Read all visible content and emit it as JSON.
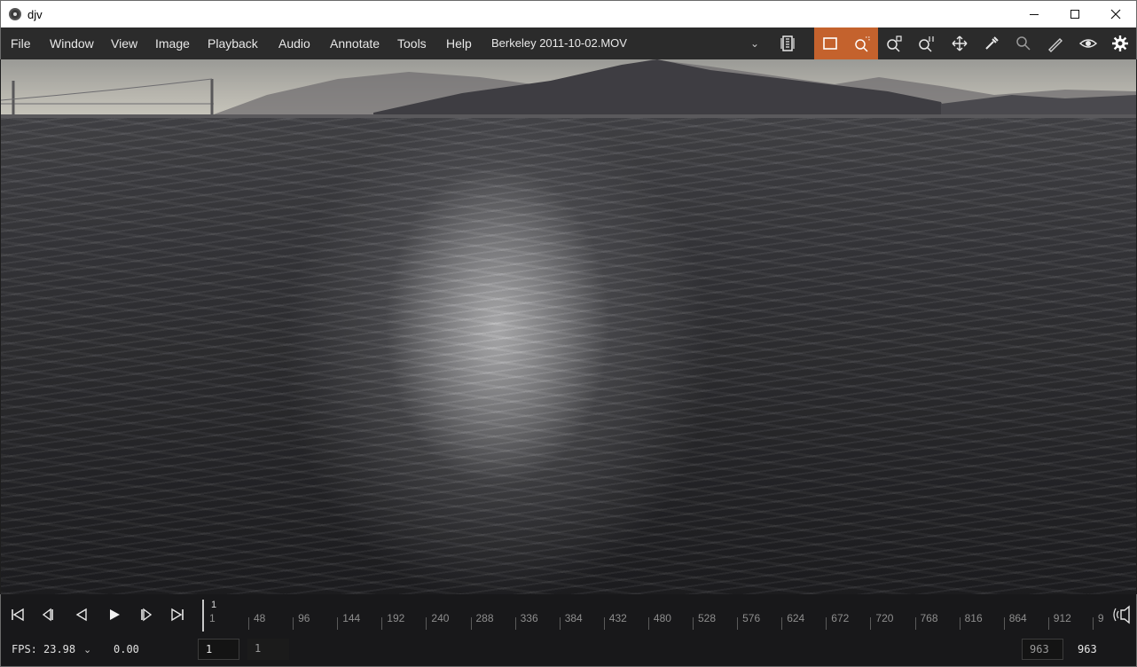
{
  "window": {
    "title": "djv"
  },
  "menu": {
    "items": [
      {
        "label": "File"
      },
      {
        "label": "Window"
      },
      {
        "label": "View"
      },
      {
        "label": "Image"
      },
      {
        "label": "Playback"
      },
      {
        "label": "Audio"
      },
      {
        "label": "Annotate"
      },
      {
        "label": "Tools"
      },
      {
        "label": "Help"
      }
    ],
    "current_file": "Berkeley 2011-10-02.MOV"
  },
  "toolbar": {
    "tools": [
      {
        "icon": "file-sequence-icon",
        "active": false
      },
      {
        "icon": "frame-view-icon",
        "active": true
      },
      {
        "icon": "zoom-fit-icon",
        "active": true
      },
      {
        "icon": "zoom-in-icon",
        "active": false
      },
      {
        "icon": "zoom-one-to-one-icon",
        "active": false
      },
      {
        "icon": "pan-move-icon",
        "active": false
      },
      {
        "icon": "color-picker-icon",
        "active": false
      },
      {
        "icon": "magnify-icon",
        "active": false
      },
      {
        "icon": "annotate-pen-icon",
        "active": false
      },
      {
        "icon": "eye-icon",
        "active": false
      },
      {
        "icon": "settings-gear-icon",
        "active": false
      }
    ],
    "accent_color": "#c4622d"
  },
  "timeline": {
    "current_frame": "1",
    "ticks": [
      "1",
      "48",
      "96",
      "144",
      "192",
      "240",
      "288",
      "336",
      "384",
      "432",
      "480",
      "528",
      "576",
      "624",
      "672",
      "720",
      "768",
      "816",
      "864",
      "912",
      "9"
    ]
  },
  "status": {
    "fps_label": "FPS:",
    "fps_value": "23.98",
    "speed": "0.00",
    "in_point": "1",
    "current_frame_display": "1",
    "out_point": "963",
    "duration": "963"
  }
}
